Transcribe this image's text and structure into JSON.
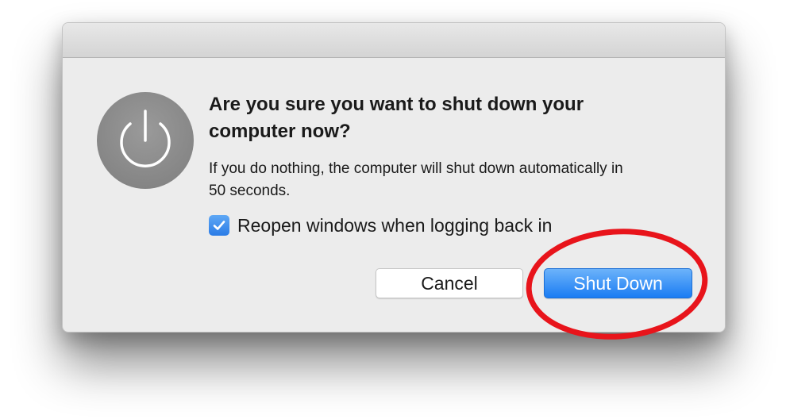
{
  "dialog": {
    "heading": "Are you sure you want to shut down your computer now?",
    "message": "If you do nothing, the computer will shut down automatically in 50 seconds.",
    "icon": "power-icon",
    "checkbox": {
      "label": "Reopen windows when logging back in",
      "checked": true
    },
    "buttons": {
      "cancel": "Cancel",
      "shut_down": "Shut Down"
    }
  },
  "annotation": {
    "shape": "ellipse",
    "color": "#e8141b",
    "target": "shut-down-button"
  },
  "colors": {
    "accent": "#1a7cf3",
    "dialog_bg": "#ececec",
    "icon_bg": "#8e8e8e"
  }
}
